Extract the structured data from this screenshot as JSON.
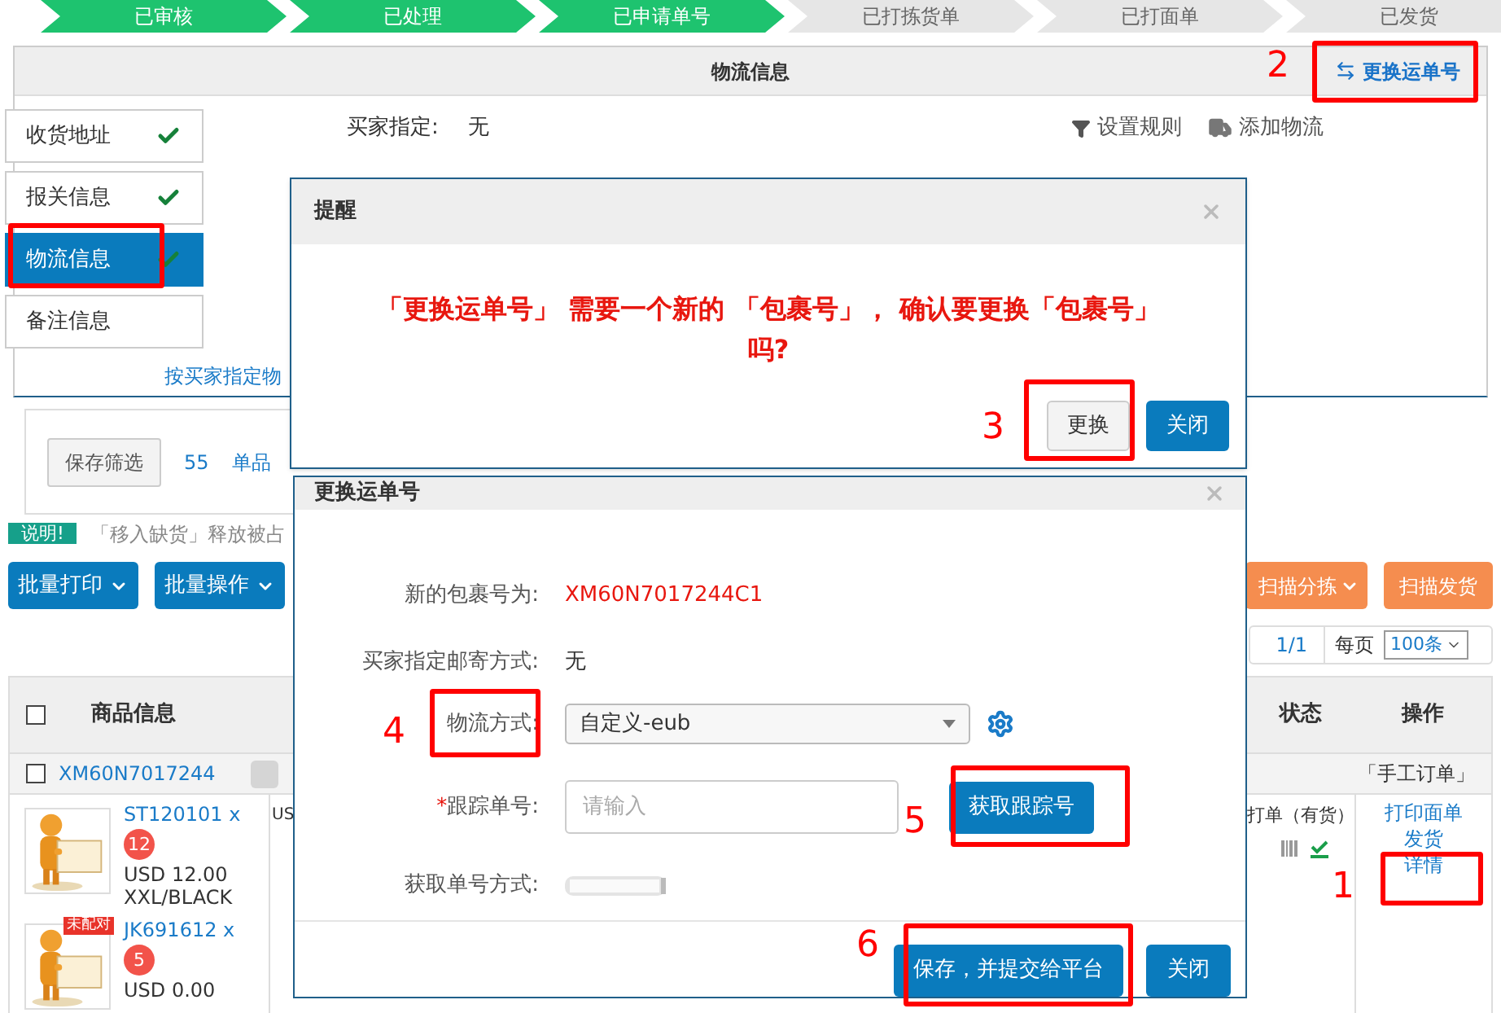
{
  "steps": [
    {
      "label": "已审核",
      "done": true
    },
    {
      "label": "已处理",
      "done": true
    },
    {
      "label": "已申请单号",
      "done": true
    },
    {
      "label": "已打拣货单",
      "done": false
    },
    {
      "label": "已打面单",
      "done": false
    },
    {
      "label": "已发货",
      "done": false
    }
  ],
  "panel": {
    "title": "物流信息",
    "action": "更换运单号"
  },
  "side_tabs": [
    {
      "label": "收货地址",
      "checked": true,
      "selected": false
    },
    {
      "label": "报关信息",
      "checked": true,
      "selected": false
    },
    {
      "label": "物流信息",
      "checked": true,
      "selected": true
    },
    {
      "label": "备注信息",
      "checked": false,
      "selected": false
    }
  ],
  "buyer_specified": {
    "label": "买家指定:",
    "value": "无"
  },
  "tools": [
    "设置规则",
    "添加物流"
  ],
  "rule_link": "按买家指定物",
  "filter": {
    "save": "保存筛选",
    "count": "55",
    "tab": "单品"
  },
  "notice": {
    "badge": "说明!",
    "text": "「移入缺货」释放被占"
  },
  "left_buttons": [
    "批量打印",
    "批量操作"
  ],
  "right_buttons": [
    {
      "label": "扫描分拣",
      "dropdown": true
    },
    {
      "label": "扫描发货",
      "dropdown": false
    }
  ],
  "pagination": {
    "page": "1/1",
    "per_page_label": "每页",
    "per_page": "100条"
  },
  "table": {
    "columns": [
      "商品信息",
      "状态",
      "操作"
    ],
    "all_checked": false,
    "order": {
      "id": "XM60N7017244",
      "source": "「手工订单」",
      "checked": false
    },
    "items": [
      {
        "sku": "ST120101 x",
        "qty": "12",
        "price": "USD 12.00",
        "variant": "XXL/BLACK"
      },
      {
        "sku": "JK691612 x",
        "qty": "5",
        "price": "USD 0.00",
        "tag": "未配对"
      }
    ],
    "price_cell": "US",
    "status": "打单（有货）",
    "actions": [
      "打印面单",
      "发货",
      "详情"
    ]
  },
  "alert": {
    "title": "提醒",
    "message": "「更换运单号」 需要一个新的 「包裹号」， 确认要更换「包裹号」吗?",
    "buttons": [
      "更换",
      "关闭"
    ]
  },
  "change_dialog": {
    "title": "更换运单号",
    "fields": [
      {
        "kind": "text",
        "label": "新的包裹号为:",
        "value": "XM60N7017244C1",
        "highlight": true
      },
      {
        "kind": "text",
        "label": "买家指定邮寄方式:",
        "value": "无",
        "highlight": false
      },
      {
        "kind": "select",
        "label": "物流方式:",
        "value": "自定义-eub"
      },
      {
        "kind": "input",
        "label": "跟踪单号:",
        "required": "*",
        "placeholder": "请输入",
        "button": "获取跟踪号"
      },
      {
        "kind": "blurred",
        "label": "获取单号方式:"
      }
    ],
    "buttons": [
      "保存，并提交给平台",
      "关闭"
    ]
  },
  "annotations": [
    {
      "number": "2"
    },
    {
      "number": "3"
    },
    {
      "number": "4"
    },
    {
      "number": "5"
    },
    {
      "number": "6"
    },
    {
      "number": "1"
    }
  ]
}
